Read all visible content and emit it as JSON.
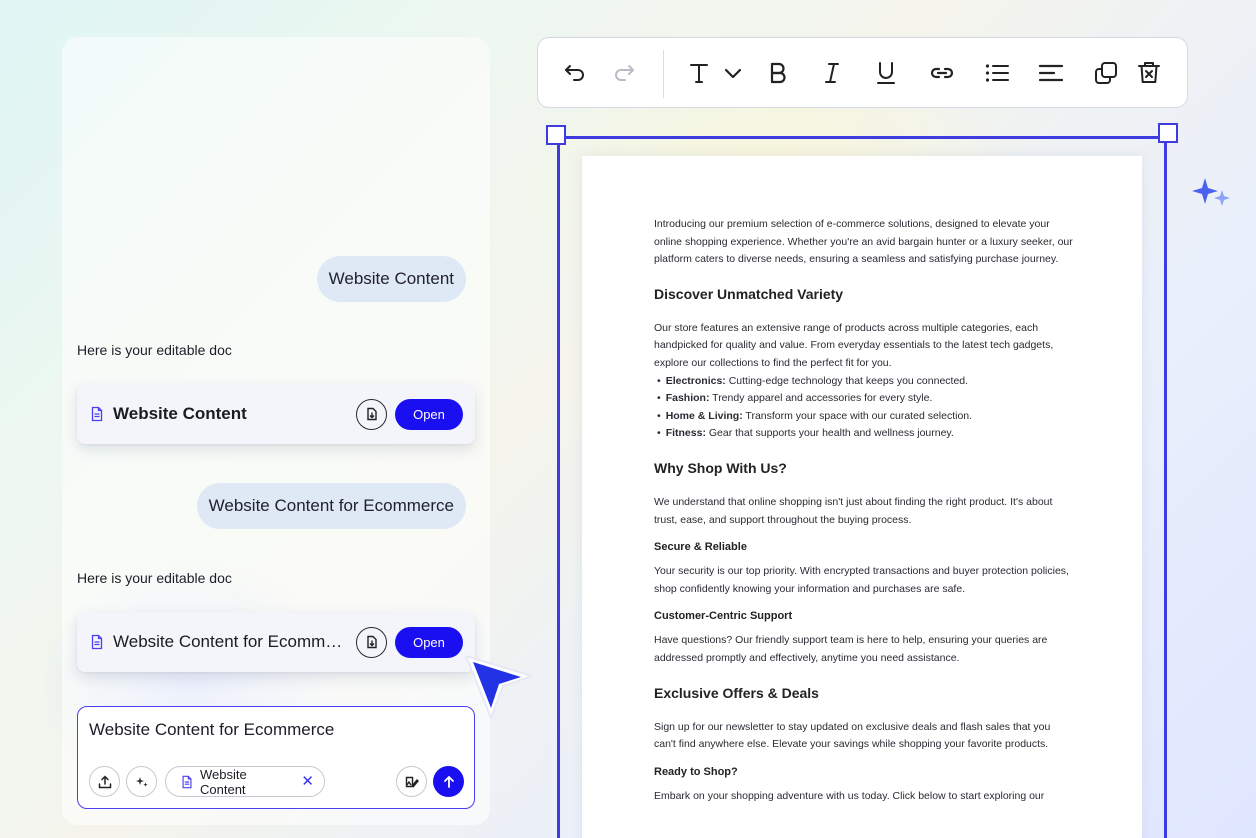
{
  "chat": {
    "messages": [
      {
        "role": "user",
        "text": "Website Content"
      },
      {
        "role": "assistant",
        "text": "Here is your editable doc"
      },
      {
        "role": "user",
        "text": "Website Content for Ecommerce"
      },
      {
        "role": "assistant",
        "text": "Here is your editable doc"
      }
    ],
    "doc_cards": [
      {
        "title": "Website Content",
        "open_label": "Open"
      },
      {
        "title": "Website Content for Ecommerce",
        "open_label": "Open"
      }
    ],
    "input": {
      "value": "Website Content for Ecommerce",
      "chip_label": "Website Content",
      "chip_remove": "✕"
    }
  },
  "toolbar": {
    "icons": [
      "undo-icon",
      "redo-icon",
      "text-style-icon",
      "chevron-down-icon",
      "bold-icon",
      "italic-icon",
      "underline-icon",
      "link-icon",
      "bulleted-list-icon",
      "align-left-icon",
      "duplicate-icon",
      "delete-icon"
    ]
  },
  "document": {
    "intro": "Introducing our premium selection of e-commerce solutions, designed to elevate your online shopping experience. Whether you're an avid bargain hunter or a luxury seeker, our platform caters to diverse needs, ensuring a seamless and satisfying purchase journey.",
    "s1_heading": "Discover Unmatched Variety",
    "s1_para": "Our store features an extensive range of products across multiple categories, each handpicked for quality and value. From everyday essentials to the latest tech gadgets, explore our collections to find the perfect fit for you.",
    "s1_list": [
      {
        "term": "Electronics:",
        "desc": " Cutting-edge technology that keeps you connected."
      },
      {
        "term": "Fashion:",
        "desc": " Trendy apparel and accessories for every style."
      },
      {
        "term": "Home & Living:",
        "desc": " Transform your space with our curated selection."
      },
      {
        "term": "Fitness:",
        "desc": " Gear that supports your health and wellness journey."
      }
    ],
    "s2_heading": "Why Shop With Us?",
    "s2_para": "We understand that online shopping isn't just about finding the right product. It's about trust, ease, and support throughout the buying process.",
    "s2a_heading": "Secure & Reliable",
    "s2a_para": "Your security is our top priority. With encrypted transactions and buyer protection policies, shop confidently knowing your information and purchases are safe.",
    "s2b_heading": "Customer-Centric Support",
    "s2b_para": "Have questions? Our friendly support team is here to help, ensuring your queries are addressed promptly and effectively, anytime you need assistance.",
    "s3_heading": "Exclusive Offers & Deals",
    "s3_para": "Sign up for our newsletter to stay updated on exclusive deals and flash sales that you can't find anywhere else. Elevate your savings while shopping your favorite products.",
    "s4_heading": "Ready to Shop?",
    "s4_para": "Embark on your shopping adventure with us today. Click below to start exploring our"
  },
  "colors": {
    "accent": "#1a0ff0",
    "frame": "#3e3be0",
    "bubble": "#dfe9f6"
  }
}
